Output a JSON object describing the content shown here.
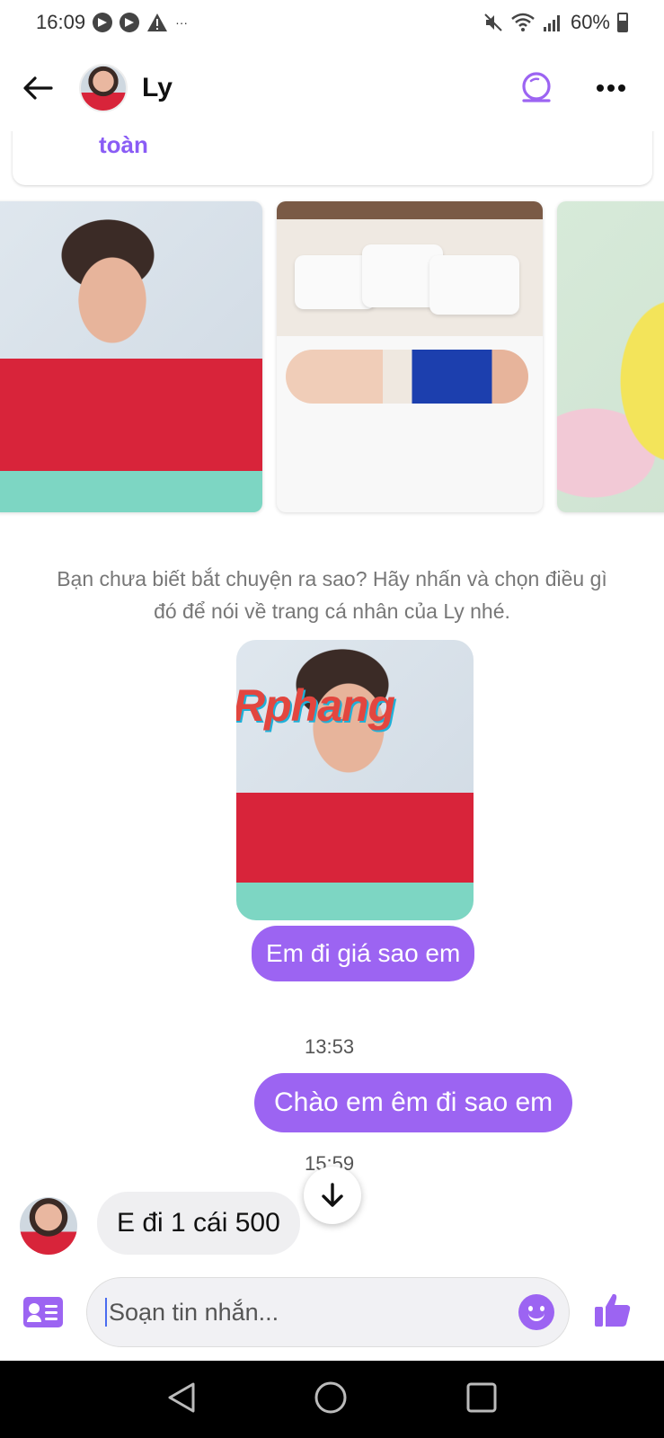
{
  "status_bar": {
    "time": "16:09",
    "battery": "60%",
    "extra": "···"
  },
  "header": {
    "contact_name": "Ly"
  },
  "profile_card": {
    "text": "toàn"
  },
  "conversation": {
    "hint": "Bạn chưa biết bắt chuyện ra sao? Hãy nhấn và chọn điều gì đó để nói về trang cá nhân của Ly nhé.",
    "watermark": "Rphang",
    "messages": [
      {
        "text": "Em đi giá sao em"
      },
      {
        "timestamp": "13:53"
      },
      {
        "text": "Chào em êm đi sao em"
      },
      {
        "timestamp": "15:59"
      },
      {
        "text": "E đi 1 cái 500"
      }
    ]
  },
  "composer": {
    "placeholder": "Soạn tin nhắn..."
  },
  "colors": {
    "accent": "#9c64f2",
    "incoming_bubble": "#efeff1"
  }
}
